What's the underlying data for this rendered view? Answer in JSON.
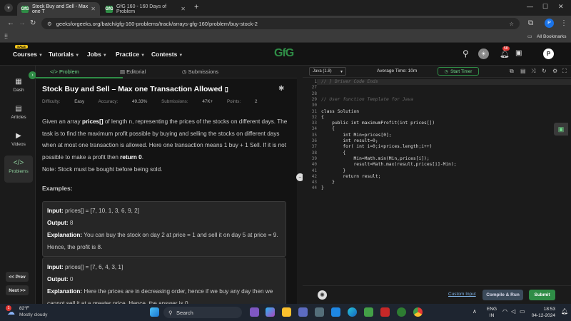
{
  "browser": {
    "tabs": [
      {
        "title": "Stock Buy and Sell - Max one T",
        "icon": "gfg-favicon",
        "active": true
      },
      {
        "title": "GfG 160 - 160 Days of Problem",
        "icon": "gfg-favicon",
        "active": false
      }
    ],
    "favicon_text": "GfG",
    "url": "geeksforgeeks.org/batch/gfg-160-problems/track/arrays-gfg-160/problem/buy-stock-2",
    "all_bookmarks": "All Bookmarks",
    "profile_initial": "P"
  },
  "site": {
    "sale_badge": "SALE",
    "menu": [
      "Courses",
      "Tutorials",
      "Jobs",
      "Practice",
      "Contests"
    ],
    "logo": "GfG",
    "notification_count": "58",
    "profile_initial": "P"
  },
  "rail": {
    "items": [
      {
        "label": "Dash",
        "icon": "dashboard-icon"
      },
      {
        "label": "Articles",
        "icon": "articles-icon"
      },
      {
        "label": "Videos",
        "icon": "videos-icon"
      },
      {
        "label": "Problems",
        "icon": "problems-icon",
        "active": true
      }
    ],
    "prev": "<< Prev",
    "next": "Next >>"
  },
  "problem_tabs": [
    "Problem",
    "Editorial",
    "Submissions"
  ],
  "problem": {
    "title": "Stock Buy and Sell – Max one Transaction Allowed",
    "meta": {
      "difficulty_label": "Difficulty:",
      "difficulty": "Easy",
      "accuracy_label": "Accuracy:",
      "accuracy": "49.33%",
      "submissions_label": "Submissions:",
      "submissions": "47K+",
      "points_label": "Points:",
      "points": "2"
    },
    "description": {
      "p1": "Given an array ",
      "p1_bold": "prices[]",
      "p2": " of length n, representing the prices of the stocks on different days. The task is to find the maximum profit possible by buying and selling the stocks on different days when at most one transaction is allowed. Here one transaction means 1 buy + 1 Sell. If it is not possible to make a profit then ",
      "p2_bold": "return 0",
      "p3": "."
    },
    "note": "Note: Stock must be bought before being sold.",
    "examples_heading": "Examples:",
    "examples": [
      {
        "input_label": "Input:",
        "input": "prices[] = [7, 10, 1, 3, 6, 9, 2]",
        "output_label": "Output:",
        "output": "8",
        "explanation_label": "Explanation:",
        "explanation": "You can buy the stock on day 2 at price = 1 and sell it on day 5 at price = 9. Hence, the profit is 8."
      },
      {
        "input_label": "Input:",
        "input": "prices[] = [7, 6, 4, 3, 1]",
        "output_label": "Output:",
        "output": "0",
        "explanation_label": "Explanation:",
        "explanation": "Here the prices are in decreasing order, hence if we buy any day then we cannot sell it at a greater price. Hence, the answer is 0."
      }
    ]
  },
  "editor": {
    "language": "Java (1.8)",
    "avg_time": "Average Time: 10m",
    "start_timer": "Start Timer",
    "lines": [
      {
        "n": "1",
        "text": "// } Driver Code Ends",
        "comment": true
      },
      {
        "n": "27",
        "text": ""
      },
      {
        "n": "28",
        "text": ""
      },
      {
        "n": "29",
        "text": "// User function Template for Java",
        "comment": true
      },
      {
        "n": "30",
        "text": ""
      },
      {
        "n": "31",
        "text": "class Solution"
      },
      {
        "n": "32",
        "text": "{"
      },
      {
        "n": "33",
        "text": "    public int maximumProfit(int prices[])"
      },
      {
        "n": "34",
        "text": "    {"
      },
      {
        "n": "35",
        "text": "        int Min=prices[0];"
      },
      {
        "n": "36",
        "text": "        int result=0;"
      },
      {
        "n": "37",
        "text": "        for( int i=0;i<prices.length;i++)"
      },
      {
        "n": "38",
        "text": "        {"
      },
      {
        "n": "39",
        "text": "            Min=Math.min(Min,prices[i]);"
      },
      {
        "n": "40",
        "text": "            result=Math.max(result,prices[i]-Min);"
      },
      {
        "n": "41",
        "text": "        }"
      },
      {
        "n": "42",
        "text": "        return result;"
      },
      {
        "n": "43",
        "text": "    }"
      },
      {
        "n": "44",
        "text": "}"
      }
    ],
    "custom_input": "Custom Input",
    "compile_run": "Compile & Run",
    "submit": "Submit"
  },
  "taskbar": {
    "weather_temp": "82°F",
    "weather_desc": "Mostly cloudy",
    "weather_badge": "1",
    "search": "Search",
    "lang1": "ENG",
    "lang2": "IN",
    "time": "18:53",
    "date": "04-12-2024"
  },
  "colors": {
    "accent_green": "#2f8d46",
    "background": "#131313",
    "submit": "#2f8d46"
  }
}
